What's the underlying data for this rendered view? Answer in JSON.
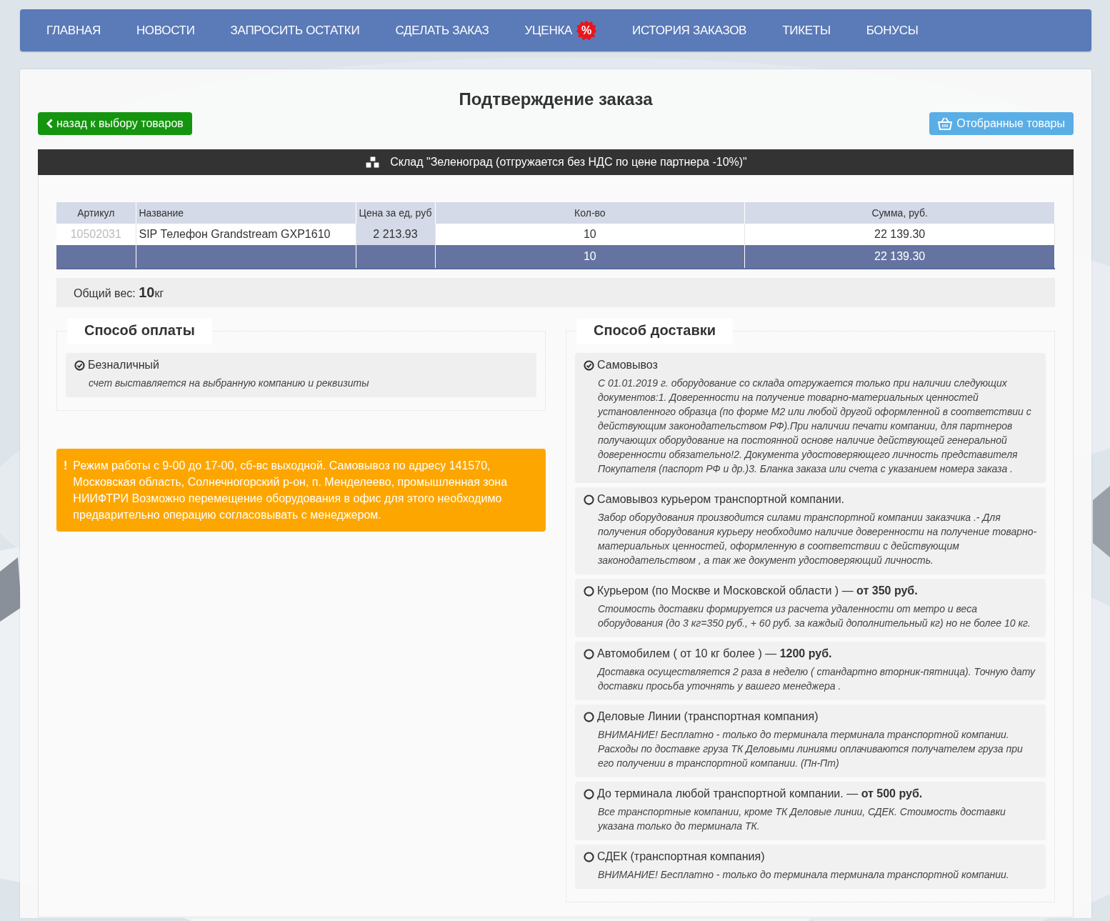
{
  "nav": {
    "items": [
      {
        "label": "ГЛАВНАЯ"
      },
      {
        "label": "НОВОСТИ"
      },
      {
        "label": "ЗАПРОСИТЬ ОСТАТКИ"
      },
      {
        "label": "СДЕЛАТЬ ЗАКАЗ"
      },
      {
        "label": "УЦЕНКА",
        "badge": "%"
      },
      {
        "label": "ИСТОРИЯ ЗАКАЗОВ"
      },
      {
        "label": "ТИКЕТЫ"
      },
      {
        "label": "БОНУСЫ"
      }
    ]
  },
  "title": "Подтверждение заказа",
  "back_button": "назад к выбору товаров",
  "selected_button": "Отобранные товары",
  "warehouse": "Склад \"Зеленоград (отгружается без НДС по цене партнера -10%)\"",
  "table": {
    "columns": [
      "Артикул",
      "Название",
      "Цена за ед, руб",
      "Кол-во",
      "Сумма, руб."
    ],
    "rows": [
      {
        "article": "10502031",
        "name": "SIP Телефон Grandstream GXP1610",
        "price": "2 213.93",
        "quantity": "10",
        "sum": "22 139.30"
      }
    ],
    "total": {
      "quantity": "10",
      "sum": "22 139.30"
    }
  },
  "weight": {
    "label": "Общий вес:",
    "value": "10",
    "unit": "кг"
  },
  "payment": {
    "legend": "Способ оплаты",
    "options": [
      {
        "label": "Безналичный",
        "description": "счет выставляется на выбранную компанию и реквизиты",
        "selected": true
      }
    ]
  },
  "notice": {
    "icon": "!",
    "text": "Режим работы с 9-00 до 17-00, сб-вс выходной. Самовывоз по адресу 141570, Московская область, Солнечногорский р-он, п. Менделеево, промышленная зона НИИФТРИ Возможно перемещение оборудования в офис для этого необходимо предварительно операцию согласовывать с менеджером."
  },
  "delivery": {
    "legend": "Способ доставки",
    "options": [
      {
        "label": "Самовывоз",
        "description": "С 01.01.2019 г. оборудование со склада отгружается только при наличии следующих документов:1. Доверенности на получение товарно-материальных ценностей установленного образца (по форме М2 или любой другой оформленной в соответствии с действующим законодательством РФ).При наличии печати компании, для партнеров получающих оборудование на постоянной основе наличие действующей генеральной доверенности обязательно!2. Документа удостоверяющего личность представителя Покупателя (паспорт РФ и др.)3. Бланка заказа или счета с указанием номера заказа .",
        "selected": true
      },
      {
        "label": "Самовывоз курьером транспортной компании.",
        "description": "Забор оборудования производится силами транспортной компании заказчика .- Для получения оборудования курьеру необходимо наличие доверенности на получение товарно-материальных ценностей, оформленную в соответствии с действующим законодательством , а так же документ удостоверяющий личность.",
        "selected": false
      },
      {
        "label": "Курьером (по Москве и Московской области ) — **от 350 руб.**",
        "description": "Стоимость доставки формируется из расчета удаленности от метро и веса оборудования (до 3 кг=350 руб., + 60 руб. за каждый дополнительный кг) но не более 10 кг.",
        "selected": false
      },
      {
        "label": "Автомобилем ( от 10 кг более ) — **1200 руб.**",
        "description": "Доставка осуществляется 2 раза в неделю ( стандартно вторник-пятница). Точную дату доставки просьба уточнять у вашего менеджера .",
        "selected": false
      },
      {
        "label": "Деловые Линии (транспортная компания)",
        "description": "ВНИМАНИЕ! Бесплатно - только до терминала терминала транспортной компании. Расходы по доставке груза ТК Деловыми линиями оплачиваются получателем груза при его получении в транспортной компании. (Пн-Пт)",
        "selected": false
      },
      {
        "label": "До терминала любой транспортной компании. — **от 500 руб.**",
        "description": "Все транспортные компании, кроме ТК Деловые линии, СДЕК. Стоимость доставки указана только до терминала ТК.",
        "selected": false
      },
      {
        "label": "СДЕК (транспортная компания)",
        "description": "ВНИМАНИЕ! Бесплатно - только до терминала терминала транспортной компании.",
        "selected": false
      }
    ]
  }
}
